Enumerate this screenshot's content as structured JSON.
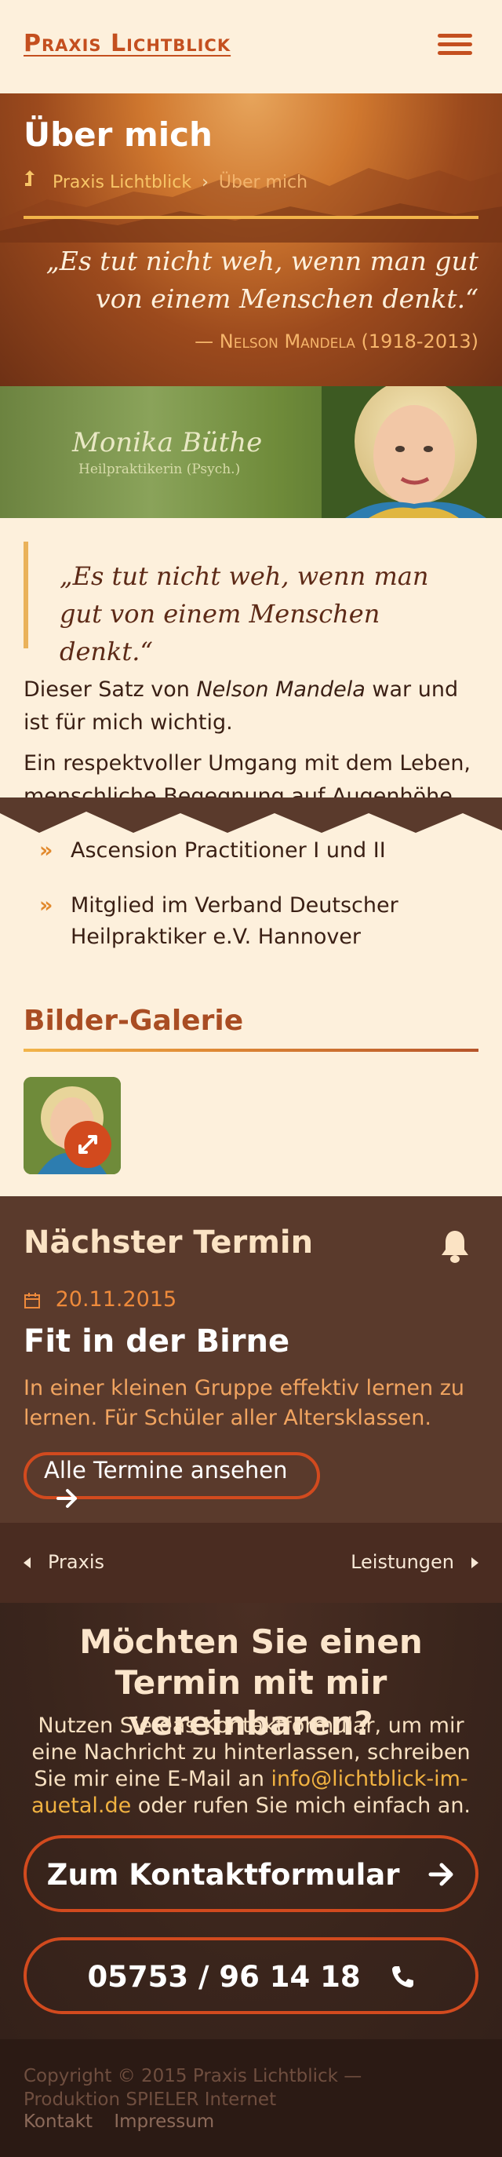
{
  "header": {
    "logo": "Praxis Lichtblick",
    "menu_icon": "hamburger-menu-icon"
  },
  "hero": {
    "title": "Über mich",
    "breadcrumb": {
      "home_icon": "up-arrow-icon",
      "home_label": "Praxis Lichtblick",
      "separator": "›",
      "current": "Über mich"
    },
    "quote": "„Es tut nicht weh, wenn man gut von einem Menschen denkt.“",
    "attribution": "— Nelson Mandela (1918-2013)"
  },
  "banner": {
    "name": "Monika Büthe",
    "subtitle": "Heilpraktikerin (Psych.)"
  },
  "content": {
    "blockquote": "„Es tut nicht weh, wenn man gut von einem Menschen denkt.“",
    "para1_before": "Dieser Satz von ",
    "para1_name": "Nelson Mandela",
    "para1_after": " war und ist für mich wichtig.",
    "para2": "Ein respektvoller Umgang mit dem Leben, menschliche Begegnung auf Augenhöhe",
    "qualifications": [
      "Ascension Practitioner I und II",
      "Mitglied im Verband Deutscher Heilpraktiker e.V. Hannover"
    ],
    "bullet": "»",
    "gallery_title": "Bilder-Galerie",
    "expand_icon": "expand-arrows-icon"
  },
  "termin": {
    "title": "Nächster Termin",
    "bell_icon": "bell-icon",
    "calendar_icon": "calendar-icon",
    "date": "20.11.2015",
    "event": "Fit in der Birne",
    "description": "In einer kleinen Gruppe effektiv lernen zu lernen. Für Schüler aller Altersklassen.",
    "button_label": "Alle Termine ansehen"
  },
  "pager": {
    "prev": "Praxis",
    "next": "Leistungen"
  },
  "contact": {
    "heading": "Möchten Sie einen Termin mit mir vereinbaren?",
    "text_before": "Nutzen Sie das Kontaktformular, um mir eine Nachricht zu hinterlassen, schreiben Sie mir eine E-Mail an ",
    "email": "info@lichtblick-im-auetal.de",
    "text_after": " oder rufen Sie mich einfach an.",
    "form_button": "Zum Kontaktformular",
    "phone_button": "05753 / 96 14 18"
  },
  "footer": {
    "copyright": "Copyright © 2015 Praxis Lichtblick — Produktion SPIELER Internet",
    "links": [
      "Kontakt",
      "Impressum"
    ]
  },
  "colors": {
    "accent": "#d24a1e",
    "logo": "#c44f1f",
    "gold": "#f2b44a",
    "page_bg": "#fdf0dc",
    "termin_bg": "#5a3a2c",
    "footer_bg": "#2b1a14"
  }
}
